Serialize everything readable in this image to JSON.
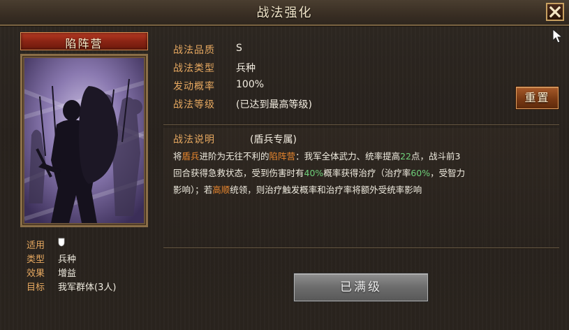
{
  "window": {
    "title": "战法强化",
    "close_icon": "close-x-icon",
    "accent_color": "#e6a860"
  },
  "card": {
    "name": "陷阵营",
    "art": "shield-soldier-silhouette"
  },
  "card_info": [
    {
      "key": "适用",
      "value": "",
      "icon": "shield-icon"
    },
    {
      "key": "类型",
      "value": "兵种"
    },
    {
      "key": "效果",
      "value": "增益"
    },
    {
      "key": "目标",
      "value": "我军群体(3人)"
    }
  ],
  "stats": [
    {
      "key": "战法品质",
      "value": "S"
    },
    {
      "key": "战法类型",
      "value": "兵种"
    },
    {
      "key": "发动概率",
      "value": "100%"
    },
    {
      "key": "战法等级",
      "value": "(已达到最高等级)"
    }
  ],
  "reset_button": "重置",
  "description": {
    "label": "战法说明",
    "tag": "(盾兵专属)",
    "line1_parts": [
      "将",
      "盾兵",
      "进阶为无往不利的",
      "陷阵营",
      "：我军全体武力、统率提高",
      "22",
      "点，战斗前3"
    ],
    "line2_parts": [
      "回合获得急救状态，受到伤害时有",
      "40%",
      "概率获得治疗（治疗率",
      "60%",
      "，受智力"
    ],
    "line3_parts": [
      "影响）；若",
      "高顺",
      "统领，则治疗触发概率和治疗率将额外受统率影响"
    ]
  },
  "max_button": "已满级"
}
